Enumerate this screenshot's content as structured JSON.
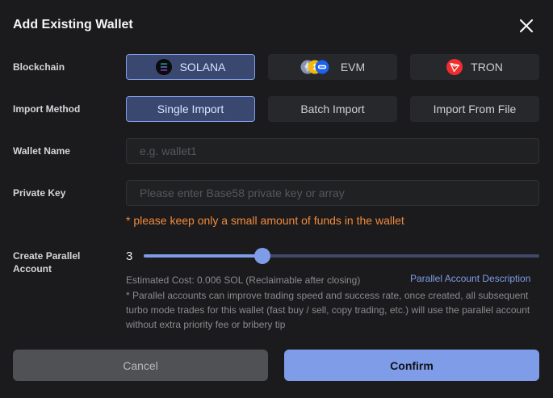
{
  "dialog": {
    "title": "Add Existing Wallet",
    "close_icon": "close-icon"
  },
  "blockchain": {
    "label": "Blockchain",
    "options": [
      {
        "label": "SOLANA",
        "icon": "solana-icon",
        "selected": true
      },
      {
        "label": "EVM",
        "icon": "evm-chains-icon",
        "selected": false
      },
      {
        "label": "TRON",
        "icon": "tron-icon",
        "selected": false
      }
    ]
  },
  "import_method": {
    "label": "Import Method",
    "options": [
      {
        "label": "Single Import",
        "selected": true
      },
      {
        "label": "Batch Import",
        "selected": false
      },
      {
        "label": "Import From File",
        "selected": false
      }
    ]
  },
  "wallet_name": {
    "label": "Wallet Name",
    "value": "",
    "placeholder": "e.g. wallet1"
  },
  "private_key": {
    "label": "Private Key",
    "value": "",
    "placeholder": "Please enter Base58 private key or array"
  },
  "warning": "* please keep only a small amount of funds in the wallet",
  "parallel": {
    "label": "Create Parallel Account",
    "value": "3",
    "slider_fraction": 0.3,
    "estimated_cost": "Estimated Cost: 0.006 SOL (Reclaimable after closing)",
    "description_link": "Parallel Account Description",
    "note": "* Parallel accounts can improve trading speed and success rate, once created, all subsequent turbo mode trades for this wallet (fast buy / sell, copy trading, etc.) will use the parallel account without extra priority fee or bribery tip"
  },
  "actions": {
    "cancel": "Cancel",
    "confirm": "Confirm"
  },
  "colors": {
    "accent": "#7f9ce8",
    "warning": "#f28a3c",
    "background": "#1b1b1d"
  }
}
